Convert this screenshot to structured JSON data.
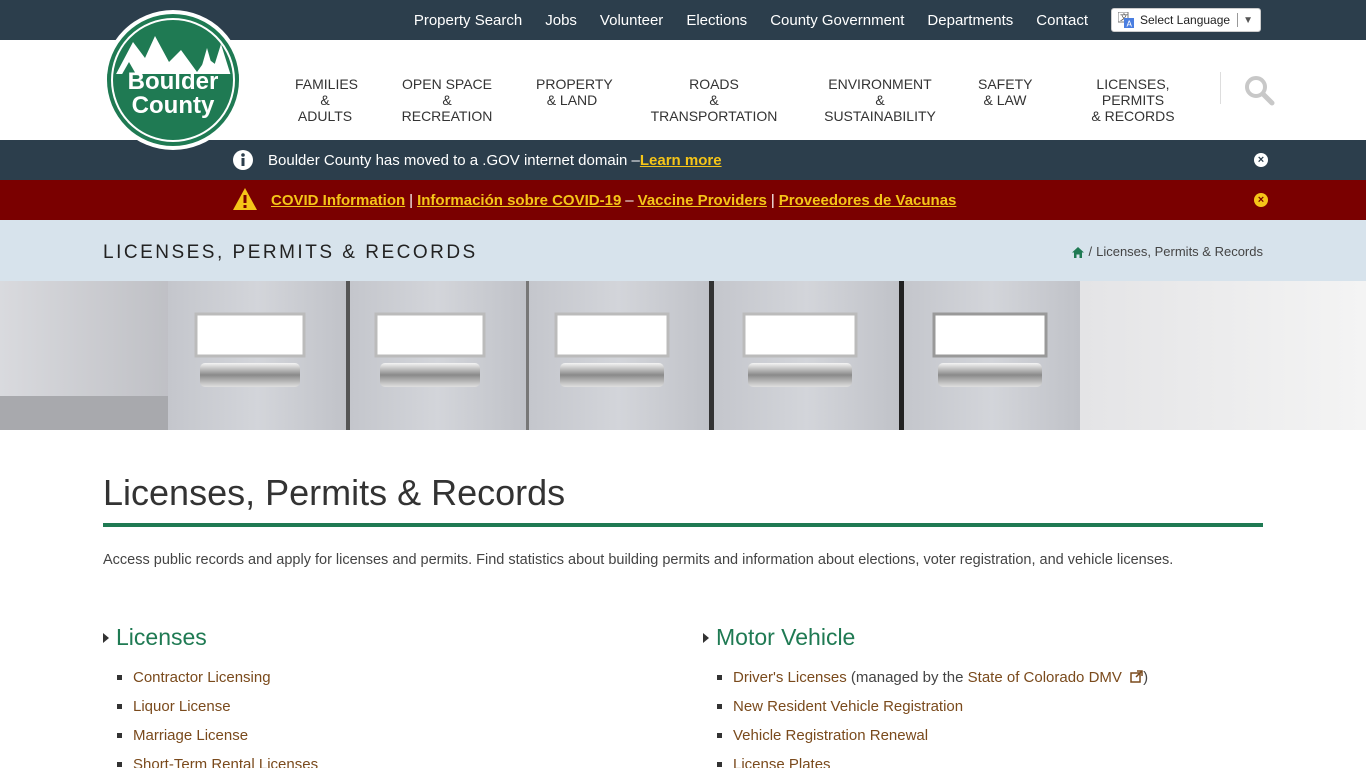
{
  "topbar": {
    "links": [
      "Property Search",
      "Jobs",
      "Volunteer",
      "Elections",
      "County Government",
      "Departments",
      "Contact"
    ],
    "language_label": "Select Language",
    "language_arrow": "▼"
  },
  "logo": {
    "line1": "Boulder",
    "line2": "County"
  },
  "nav": [
    {
      "line1": "Families",
      "line2": "& Adults"
    },
    {
      "line1": "Open Space",
      "line2": "& Recreation"
    },
    {
      "line1": "Property",
      "line2": "& Land"
    },
    {
      "line1": "Roads",
      "line2": "& Transportation"
    },
    {
      "line1": "Environment",
      "line2": "& Sustainability"
    },
    {
      "line1": "Safety",
      "line2": "& Law"
    },
    {
      "line1": "Licenses, Permits",
      "line2": "& Records"
    }
  ],
  "alerts": {
    "domain": {
      "text": "Boulder County has moved to a .GOV internet domain – ",
      "link": "Learn more"
    },
    "covid": {
      "link1": "COVID Information",
      "sep1": "|",
      "link2": "Información sobre COVID-19",
      "dash": "–",
      "link3": "Vaccine Providers",
      "sep2": "|",
      "link4": "Proveedores de Vacunas"
    }
  },
  "titleband": {
    "section_title": "Licenses, Permits & Records",
    "breadcrumb_sep": "/",
    "breadcrumb_current": "Licenses, Permits & Records"
  },
  "page": {
    "title": "Licenses, Permits & Records",
    "intro": "Access public records and apply for licenses and permits. Find statistics about building permits and information about elections, voter registration, and vehicle licenses."
  },
  "columns": {
    "licenses": {
      "heading": "Licenses",
      "items": [
        "Contractor Licensing",
        "Liquor License",
        "Marriage License",
        "Short-Term Rental Licenses"
      ]
    },
    "motor": {
      "heading": "Motor Vehicle",
      "item1_link": "Driver's Licenses",
      "item1_text": " (managed by the ",
      "item1_link2": "State of Colorado DMV",
      "item1_end": ")",
      "items": [
        "New Resident Vehicle Registration",
        "Vehicle Registration Renewal",
        "License Plates"
      ]
    }
  },
  "colors": {
    "brand_green": "#1f7a53",
    "navy": "#2c3e4c",
    "alert_red": "#7a0000",
    "link_brown": "#7a4a1c",
    "accent_yellow": "#f5c518"
  }
}
